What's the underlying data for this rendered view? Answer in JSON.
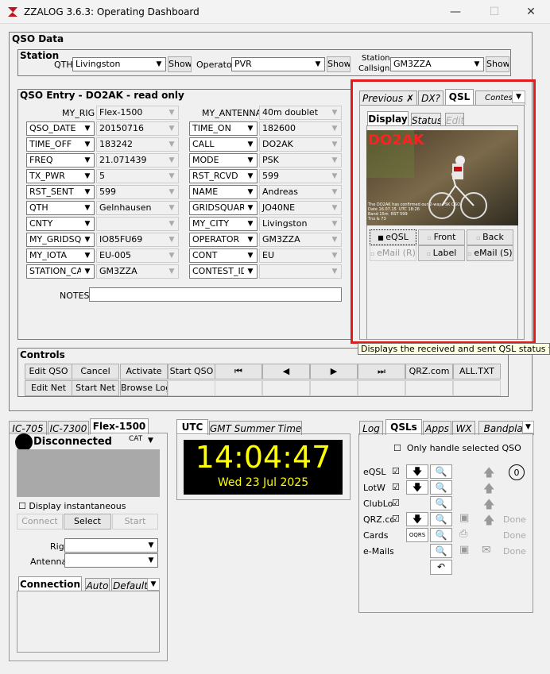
{
  "window": {
    "title": "ZZALOG 3.6.3: Operating Dashboard",
    "minimize": "—",
    "maximize": "☐",
    "close": "✕"
  },
  "qso_data": {
    "title": "QSO Data",
    "station": {
      "title": "Station",
      "qth_label": "QTH",
      "qth_value": "Livingston",
      "qth_show": "Show",
      "operator_label": "Operator",
      "operator_value": "PVR",
      "operator_show": "Show",
      "callsign_label1": "Station",
      "callsign_label2": "Callsign",
      "callsign_value": "GM3ZZA",
      "callsign_show": "Show"
    },
    "entry": {
      "title": "QSO Entry - DO2AK - read only",
      "my_rig_label": "MY_RIG",
      "my_rig_value": "Flex-1500",
      "my_antenna_label": "MY_ANTENNA",
      "my_antenna_value": "40m doublet",
      "left_rows": [
        {
          "field": "QSO_DATE",
          "value": "20150716"
        },
        {
          "field": "TIME_OFF",
          "value": "183242"
        },
        {
          "field": "FREQ",
          "value": "21.071439"
        },
        {
          "field": "TX_PWR",
          "value": "5"
        },
        {
          "field": "RST_SENT",
          "value": "599"
        },
        {
          "field": "QTH",
          "value": "Gelnhausen"
        },
        {
          "field": "CNTY",
          "value": ""
        },
        {
          "field": "MY_GRIDSQ",
          "value": "IO85FU69"
        },
        {
          "field": "MY_IOTA",
          "value": "EU-005"
        },
        {
          "field": "STATION_CA",
          "value": "GM3ZZA"
        }
      ],
      "right_rows": [
        {
          "field": "TIME_ON",
          "value": "182600"
        },
        {
          "field": "CALL",
          "value": "DO2AK"
        },
        {
          "field": "MODE",
          "value": "PSK"
        },
        {
          "field": "RST_RCVD",
          "value": "599"
        },
        {
          "field": "NAME",
          "value": "Andreas"
        },
        {
          "field": "GRIDSQUAR",
          "value": "JO40NE"
        },
        {
          "field": "MY_CITY",
          "value": "Livingston"
        },
        {
          "field": "OPERATOR",
          "value": "GM3ZZA"
        },
        {
          "field": "CONT",
          "value": "EU"
        },
        {
          "field": "CONTEST_ID",
          "value": ""
        }
      ],
      "notes_label": "NOTES",
      "notes_value": ""
    },
    "controls": {
      "title": "Controls",
      "row1": [
        "Edit QSO",
        "Cancel",
        "Activate",
        "Start QSO",
        "⏮",
        "◀",
        "▶",
        "⏭",
        "QRZ.com",
        "ALL.TXT"
      ],
      "row2": [
        "Edit Net",
        "Start Net",
        "Browse Log",
        "",
        "",
        "",
        "",
        "",
        "",
        ""
      ]
    }
  },
  "qsl_panel": {
    "tabs": [
      "Previous ✗",
      "DX?",
      "QSL",
      "Contest"
    ],
    "subtabs": [
      "Display",
      "Status",
      "Edit"
    ],
    "card_call": "DO2AK",
    "card_text": "The DO2AK has confirmed our 2-way PSK QSO\nDate 16.07.15  UTC 18:26\nBand 15m  RST 599\nTnx & 73",
    "buttons": [
      {
        "label": "eQSL",
        "disabled": false,
        "checked": true
      },
      {
        "label": "Front",
        "disabled": false,
        "checked": false
      },
      {
        "label": "Back",
        "disabled": false,
        "checked": false
      },
      {
        "label": "eMail (R)",
        "disabled": true,
        "checked": false
      },
      {
        "label": "Label",
        "disabled": false,
        "checked": false
      },
      {
        "label": "eMail (S)",
        "disabled": false,
        "checked": false
      }
    ],
    "tooltip": "Displays the received and sent QSL status for this Q"
  },
  "rig_panel": {
    "tabs": [
      "IC-705",
      "IC-7300",
      "Flex-1500"
    ],
    "status": "Disconnected",
    "cat_label": "CAT",
    "display_inst": "Display instantaneous",
    "buttons": [
      "Connect",
      "Select",
      "Start"
    ],
    "rig_label": "Rig",
    "rig_value": "",
    "antenna_label": "Antenna",
    "antenna_value": "",
    "conn_tabs": [
      "Connection",
      "Auto",
      "Default"
    ]
  },
  "clock": {
    "tabs": [
      "UTC",
      "GMT Summer Time"
    ],
    "time": "14:04:47",
    "date": "Wed 23 Jul 2025",
    "bg": "#000000",
    "fg": "#ffff00"
  },
  "qsl_mgr": {
    "tabs": [
      "Log",
      "QSLs",
      "Apps",
      "WX",
      "Bandplan"
    ],
    "only_selected": "Only handle selected QSO",
    "count": "0",
    "rows": [
      {
        "label": "eQSL",
        "check": "☑",
        "done": ""
      },
      {
        "label": "LotW",
        "check": "☑",
        "done": ""
      },
      {
        "label": "ClubLog",
        "check": "☑",
        "done": ""
      },
      {
        "label": "QRZ.com",
        "check": "☑",
        "done": "Done"
      },
      {
        "label": "Cards",
        "check": "",
        "done": "Done",
        "oqrs": "OQRS"
      },
      {
        "label": "e-Mails",
        "check": "",
        "done": "Done"
      }
    ]
  }
}
